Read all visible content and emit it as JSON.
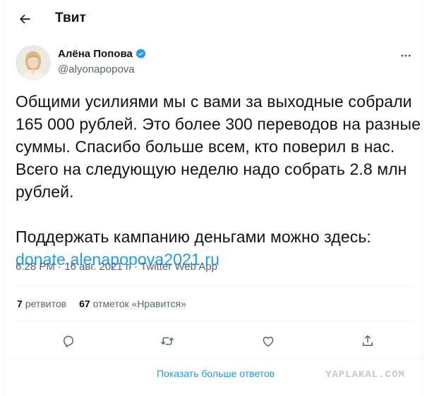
{
  "header": {
    "title": "Твит"
  },
  "author": {
    "name": "Алёна Попова",
    "handle": "@alyonapopova"
  },
  "tweet": {
    "lines": [
      "Общими усилиями мы с вами за выходные собрали",
      "165 000 рублей. Это более 300 переводов на разные",
      "суммы. Спасибо больше всем, кто поверил в нас.",
      "Всего на следующую неделю надо собрать 2.8 млн",
      "рублей."
    ],
    "support_line": "Поддержать кампанию деньгами можно здесь:",
    "link": "donate.alenapopova2021.ru"
  },
  "meta": {
    "time": "6:28 PM",
    "date": "16 авг. 2021 г.",
    "source": "Twitter Web App",
    "sep": " · "
  },
  "stats": {
    "retweets_count": "7",
    "retweets_label": "ретвитов",
    "likes_count": "67",
    "likes_label": "отметок «Нравится»"
  },
  "replies": {
    "show_more": "Показать больше ответов"
  },
  "watermark": "YAPLAKAL.COM",
  "colors": {
    "accent": "#1d9bf0",
    "muted": "#536471",
    "text": "#0f1419",
    "divider": "#eff3f4"
  }
}
